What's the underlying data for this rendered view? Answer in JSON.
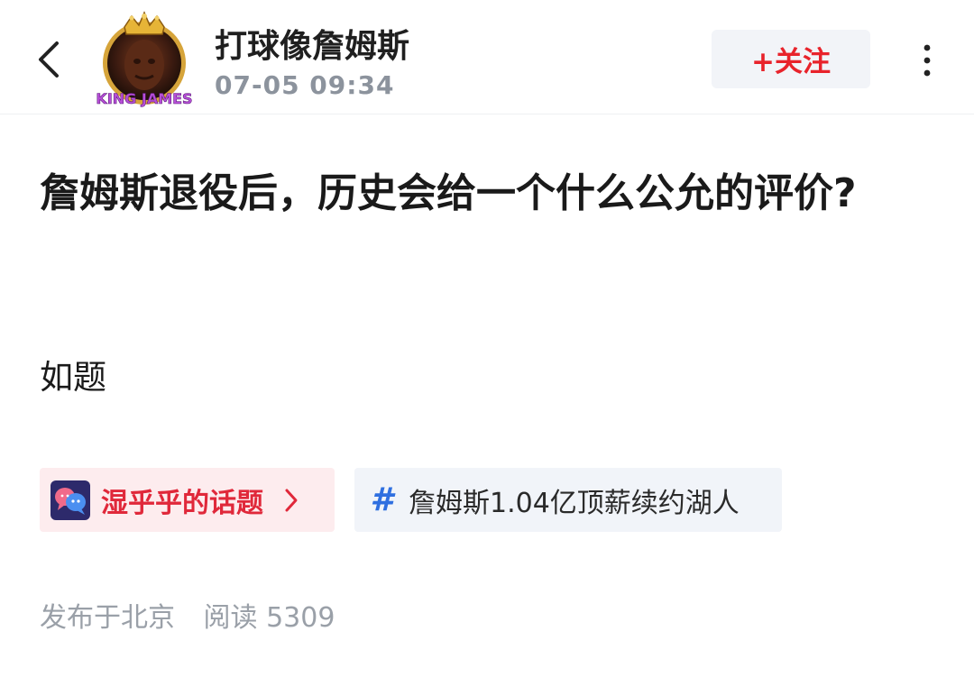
{
  "header": {
    "author_name": "打球像詹姆斯",
    "post_time": "07-05 09:34",
    "follow_label": "+关注",
    "avatar_caption": "KING JAMES"
  },
  "post": {
    "title": "詹姆斯退役后，历史会给一个什么公允的评价?",
    "body": "如题"
  },
  "topics": {
    "topic_label": "湿乎乎的话题",
    "tag_label": "詹姆斯1.04亿顶薪续约湖人"
  },
  "meta": {
    "location": "发布于北京",
    "reads": "阅读 5309"
  },
  "colors": {
    "accent_red": "#e8232b",
    "tag_blue": "#2f6fe0",
    "meta_gray": "#9aa0a8"
  },
  "icons": {
    "back": "chevron-left-icon",
    "more": "more-vertical-icon",
    "topic": "chat-bubbles-icon",
    "tag": "hash-icon",
    "chevron": "chevron-right-icon"
  }
}
